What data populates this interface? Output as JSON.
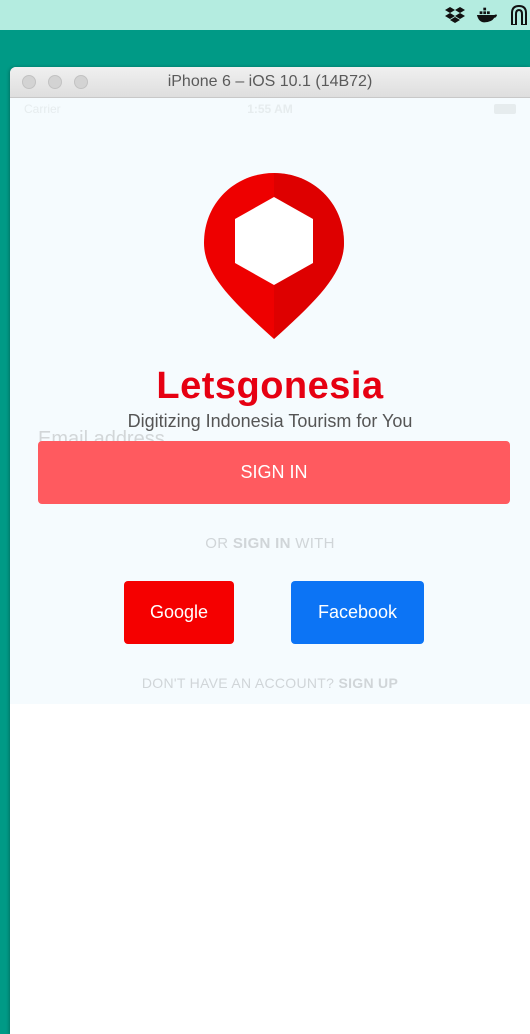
{
  "window": {
    "title": "iPhone 6 – iOS 10.1 (14B72)"
  },
  "tray": {
    "icons": [
      "dropbox-icon",
      "docker-icon",
      "arch-icon"
    ]
  },
  "status_bar": {
    "carrier": "Carrier",
    "time": "1:55 AM"
  },
  "app": {
    "name": "Letsgonesia",
    "tagline": "Digitizing Indonesia Tourism for You",
    "brand_color": "#e60012"
  },
  "form": {
    "email_placeholder": "Email address",
    "signin_label": "SIGN IN",
    "signin_color": "#ff5a5f"
  },
  "social": {
    "prefix": "OR ",
    "emphasis": "SIGN IN",
    "suffix": " WITH",
    "google_label": "Google",
    "google_color": "#f50000",
    "facebook_label": "Facebook",
    "facebook_color": "#0c74f5"
  },
  "signup": {
    "prompt": "DON'T HAVE AN ACCOUNT? ",
    "link": "SIGN UP"
  }
}
